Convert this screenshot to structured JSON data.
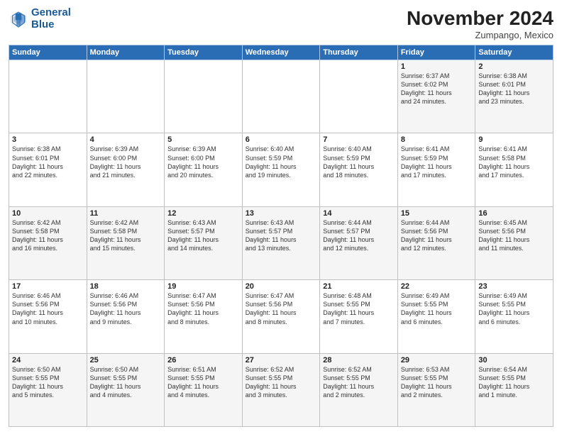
{
  "header": {
    "logo_line1": "General",
    "logo_line2": "Blue",
    "month_title": "November 2024",
    "location": "Zumpango, Mexico"
  },
  "days_of_week": [
    "Sunday",
    "Monday",
    "Tuesday",
    "Wednesday",
    "Thursday",
    "Friday",
    "Saturday"
  ],
  "weeks": [
    [
      {
        "day": "",
        "info": ""
      },
      {
        "day": "",
        "info": ""
      },
      {
        "day": "",
        "info": ""
      },
      {
        "day": "",
        "info": ""
      },
      {
        "day": "",
        "info": ""
      },
      {
        "day": "1",
        "info": "Sunrise: 6:37 AM\nSunset: 6:02 PM\nDaylight: 11 hours\nand 24 minutes."
      },
      {
        "day": "2",
        "info": "Sunrise: 6:38 AM\nSunset: 6:01 PM\nDaylight: 11 hours\nand 23 minutes."
      }
    ],
    [
      {
        "day": "3",
        "info": "Sunrise: 6:38 AM\nSunset: 6:01 PM\nDaylight: 11 hours\nand 22 minutes."
      },
      {
        "day": "4",
        "info": "Sunrise: 6:39 AM\nSunset: 6:00 PM\nDaylight: 11 hours\nand 21 minutes."
      },
      {
        "day": "5",
        "info": "Sunrise: 6:39 AM\nSunset: 6:00 PM\nDaylight: 11 hours\nand 20 minutes."
      },
      {
        "day": "6",
        "info": "Sunrise: 6:40 AM\nSunset: 5:59 PM\nDaylight: 11 hours\nand 19 minutes."
      },
      {
        "day": "7",
        "info": "Sunrise: 6:40 AM\nSunset: 5:59 PM\nDaylight: 11 hours\nand 18 minutes."
      },
      {
        "day": "8",
        "info": "Sunrise: 6:41 AM\nSunset: 5:59 PM\nDaylight: 11 hours\nand 17 minutes."
      },
      {
        "day": "9",
        "info": "Sunrise: 6:41 AM\nSunset: 5:58 PM\nDaylight: 11 hours\nand 17 minutes."
      }
    ],
    [
      {
        "day": "10",
        "info": "Sunrise: 6:42 AM\nSunset: 5:58 PM\nDaylight: 11 hours\nand 16 minutes."
      },
      {
        "day": "11",
        "info": "Sunrise: 6:42 AM\nSunset: 5:58 PM\nDaylight: 11 hours\nand 15 minutes."
      },
      {
        "day": "12",
        "info": "Sunrise: 6:43 AM\nSunset: 5:57 PM\nDaylight: 11 hours\nand 14 minutes."
      },
      {
        "day": "13",
        "info": "Sunrise: 6:43 AM\nSunset: 5:57 PM\nDaylight: 11 hours\nand 13 minutes."
      },
      {
        "day": "14",
        "info": "Sunrise: 6:44 AM\nSunset: 5:57 PM\nDaylight: 11 hours\nand 12 minutes."
      },
      {
        "day": "15",
        "info": "Sunrise: 6:44 AM\nSunset: 5:56 PM\nDaylight: 11 hours\nand 12 minutes."
      },
      {
        "day": "16",
        "info": "Sunrise: 6:45 AM\nSunset: 5:56 PM\nDaylight: 11 hours\nand 11 minutes."
      }
    ],
    [
      {
        "day": "17",
        "info": "Sunrise: 6:46 AM\nSunset: 5:56 PM\nDaylight: 11 hours\nand 10 minutes."
      },
      {
        "day": "18",
        "info": "Sunrise: 6:46 AM\nSunset: 5:56 PM\nDaylight: 11 hours\nand 9 minutes."
      },
      {
        "day": "19",
        "info": "Sunrise: 6:47 AM\nSunset: 5:56 PM\nDaylight: 11 hours\nand 8 minutes."
      },
      {
        "day": "20",
        "info": "Sunrise: 6:47 AM\nSunset: 5:56 PM\nDaylight: 11 hours\nand 8 minutes."
      },
      {
        "day": "21",
        "info": "Sunrise: 6:48 AM\nSunset: 5:55 PM\nDaylight: 11 hours\nand 7 minutes."
      },
      {
        "day": "22",
        "info": "Sunrise: 6:49 AM\nSunset: 5:55 PM\nDaylight: 11 hours\nand 6 minutes."
      },
      {
        "day": "23",
        "info": "Sunrise: 6:49 AM\nSunset: 5:55 PM\nDaylight: 11 hours\nand 6 minutes."
      }
    ],
    [
      {
        "day": "24",
        "info": "Sunrise: 6:50 AM\nSunset: 5:55 PM\nDaylight: 11 hours\nand 5 minutes."
      },
      {
        "day": "25",
        "info": "Sunrise: 6:50 AM\nSunset: 5:55 PM\nDaylight: 11 hours\nand 4 minutes."
      },
      {
        "day": "26",
        "info": "Sunrise: 6:51 AM\nSunset: 5:55 PM\nDaylight: 11 hours\nand 4 minutes."
      },
      {
        "day": "27",
        "info": "Sunrise: 6:52 AM\nSunset: 5:55 PM\nDaylight: 11 hours\nand 3 minutes."
      },
      {
        "day": "28",
        "info": "Sunrise: 6:52 AM\nSunset: 5:55 PM\nDaylight: 11 hours\nand 2 minutes."
      },
      {
        "day": "29",
        "info": "Sunrise: 6:53 AM\nSunset: 5:55 PM\nDaylight: 11 hours\nand 2 minutes."
      },
      {
        "day": "30",
        "info": "Sunrise: 6:54 AM\nSunset: 5:55 PM\nDaylight: 11 hours\nand 1 minute."
      }
    ]
  ]
}
